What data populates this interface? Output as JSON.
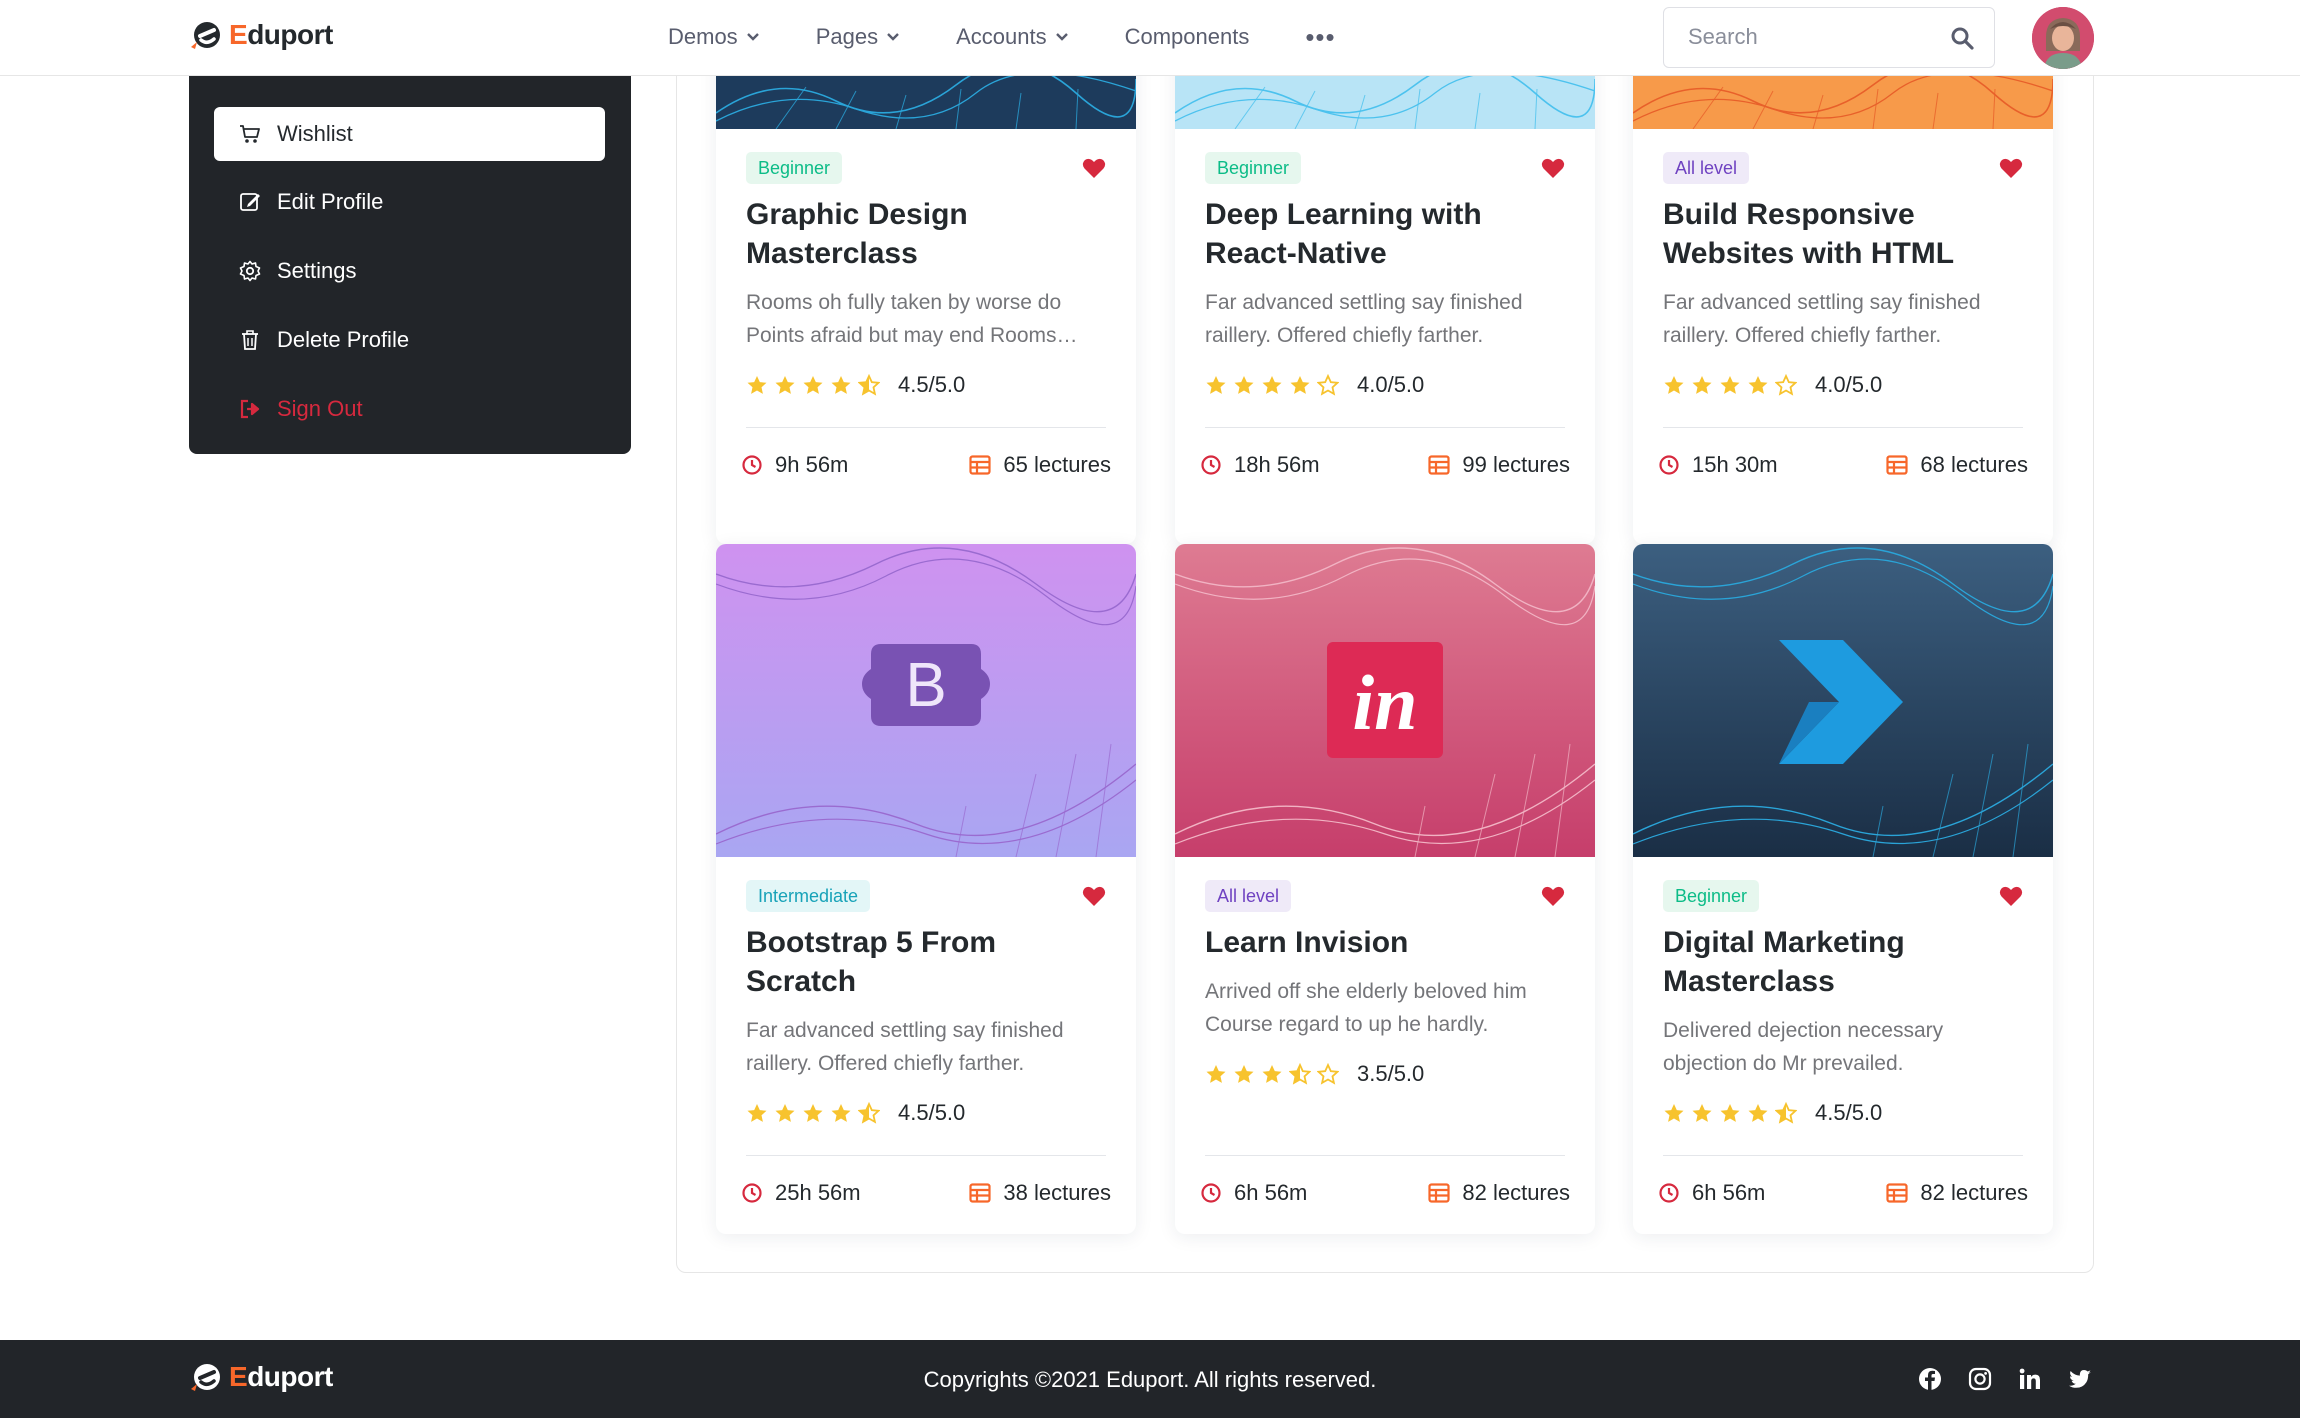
{
  "header": {
    "brand": {
      "first_letter": "E",
      "rest": "duport"
    },
    "nav": [
      {
        "label": "Demos",
        "has_dropdown": true
      },
      {
        "label": "Pages",
        "has_dropdown": true
      },
      {
        "label": "Accounts",
        "has_dropdown": true
      },
      {
        "label": "Components",
        "has_dropdown": false
      }
    ],
    "more_label": "•••",
    "search": {
      "placeholder": "Search",
      "value": ""
    }
  },
  "sidebar": {
    "items": [
      {
        "label": "Wishlist",
        "icon": "cart-icon",
        "active": true
      },
      {
        "label": "Edit Profile",
        "icon": "edit-icon",
        "active": false
      },
      {
        "label": "Settings",
        "icon": "gear-icon",
        "active": false
      },
      {
        "label": "Delete Profile",
        "icon": "trash-icon",
        "active": false
      },
      {
        "label": "Sign Out",
        "icon": "sign-out-icon",
        "active": false,
        "danger": true
      }
    ]
  },
  "courses": [
    {
      "level": "Beginner",
      "level_color": "green",
      "title_lines": [
        "Graphic Design",
        "Masterclass"
      ],
      "desc_lines": [
        "Rooms oh fully taken by worse do",
        "Points afraid but may end Rooms…"
      ],
      "rating": 4.5,
      "rating_text": "4.5/5.0",
      "duration": "9h 56m",
      "lectures": "65 lectures",
      "thumb": "navy"
    },
    {
      "level": "Beginner",
      "level_color": "green",
      "title_lines": [
        "Deep Learning with",
        "React-Native"
      ],
      "desc_lines": [
        "Far advanced settling say finished",
        "raillery. Offered chiefly farther."
      ],
      "rating": 4.0,
      "rating_text": "4.0/5.0",
      "duration": "18h 56m",
      "lectures": "99 lectures",
      "thumb": "lightblue"
    },
    {
      "level": "All level",
      "level_color": "purple",
      "title_lines": [
        "Build Responsive",
        "Websites with HTML"
      ],
      "desc_lines": [
        "Far advanced settling say finished",
        "raillery. Offered chiefly farther."
      ],
      "rating": 4.0,
      "rating_text": "4.0/5.0",
      "duration": "15h 30m",
      "lectures": "68 lectures",
      "thumb": "orange"
    },
    {
      "level": "Intermediate",
      "level_color": "teal",
      "title_lines": [
        "Bootstrap 5 From",
        "Scratch"
      ],
      "desc_lines": [
        "Far advanced settling say finished",
        "raillery. Offered chiefly farther."
      ],
      "rating": 4.5,
      "rating_text": "4.5/5.0",
      "duration": "25h 56m",
      "lectures": "38 lectures",
      "thumb": "violet",
      "logo": "B"
    },
    {
      "level": "All level",
      "level_color": "purple",
      "title_lines": [
        "Learn Invision"
      ],
      "desc_lines": [
        "Arrived off she elderly beloved him",
        "Course regard to up he hardly."
      ],
      "rating": 3.5,
      "rating_text": "3.5/5.0",
      "duration": "6h 56m",
      "lectures": "82 lectures",
      "thumb": "pink",
      "logo": "in"
    },
    {
      "level": "Beginner",
      "level_color": "green",
      "title_lines": [
        "Digital Marketing",
        "Masterclass"
      ],
      "desc_lines": [
        "Delivered dejection necessary",
        "objection do Mr prevailed."
      ],
      "rating": 4.5,
      "rating_text": "4.5/5.0",
      "duration": "6h 56m",
      "lectures": "82 lectures",
      "thumb": "darknavy"
    }
  ],
  "footer": {
    "brand": {
      "first_letter": "E",
      "rest": "duport"
    },
    "copyright": "Copyrights ©2021 Eduport. All rights reserved.",
    "social": [
      "facebook-icon",
      "instagram-icon",
      "linkedin-icon",
      "twitter-icon"
    ]
  },
  "colors": {
    "accent_orange": "#f7672a",
    "danger": "#d6293e",
    "star": "#f7c32e",
    "dark": "#222529"
  }
}
